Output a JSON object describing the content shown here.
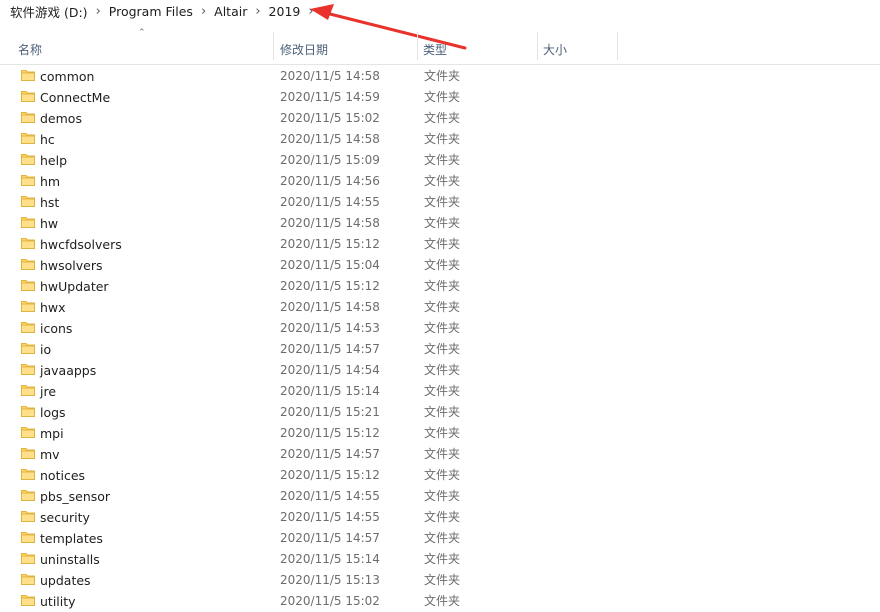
{
  "breadcrumb": {
    "items": [
      "软件游戏 (D:)",
      "Program Files",
      "Altair",
      "2019"
    ],
    "separator": "›"
  },
  "columns": {
    "name": "名称",
    "date": "修改日期",
    "type": "类型",
    "size": "大小"
  },
  "files": [
    {
      "name": "common",
      "date": "2020/11/5 14:58",
      "type": "文件夹"
    },
    {
      "name": "ConnectMe",
      "date": "2020/11/5 14:59",
      "type": "文件夹"
    },
    {
      "name": "demos",
      "date": "2020/11/5 15:02",
      "type": "文件夹"
    },
    {
      "name": "hc",
      "date": "2020/11/5 14:58",
      "type": "文件夹"
    },
    {
      "name": "help",
      "date": "2020/11/5 15:09",
      "type": "文件夹"
    },
    {
      "name": "hm",
      "date": "2020/11/5 14:56",
      "type": "文件夹"
    },
    {
      "name": "hst",
      "date": "2020/11/5 14:55",
      "type": "文件夹"
    },
    {
      "name": "hw",
      "date": "2020/11/5 14:58",
      "type": "文件夹"
    },
    {
      "name": "hwcfdsolvers",
      "date": "2020/11/5 15:12",
      "type": "文件夹"
    },
    {
      "name": "hwsolvers",
      "date": "2020/11/5 15:04",
      "type": "文件夹"
    },
    {
      "name": "hwUpdater",
      "date": "2020/11/5 15:12",
      "type": "文件夹"
    },
    {
      "name": "hwx",
      "date": "2020/11/5 14:58",
      "type": "文件夹"
    },
    {
      "name": "icons",
      "date": "2020/11/5 14:53",
      "type": "文件夹"
    },
    {
      "name": "io",
      "date": "2020/11/5 14:57",
      "type": "文件夹"
    },
    {
      "name": "javaapps",
      "date": "2020/11/5 14:54",
      "type": "文件夹"
    },
    {
      "name": "jre",
      "date": "2020/11/5 15:14",
      "type": "文件夹"
    },
    {
      "name": "logs",
      "date": "2020/11/5 15:21",
      "type": "文件夹"
    },
    {
      "name": "mpi",
      "date": "2020/11/5 15:12",
      "type": "文件夹"
    },
    {
      "name": "mv",
      "date": "2020/11/5 14:57",
      "type": "文件夹"
    },
    {
      "name": "notices",
      "date": "2020/11/5 15:12",
      "type": "文件夹"
    },
    {
      "name": "pbs_sensor",
      "date": "2020/11/5 14:55",
      "type": "文件夹"
    },
    {
      "name": "security",
      "date": "2020/11/5 14:55",
      "type": "文件夹"
    },
    {
      "name": "templates",
      "date": "2020/11/5 14:57",
      "type": "文件夹"
    },
    {
      "name": "uninstalls",
      "date": "2020/11/5 15:14",
      "type": "文件夹"
    },
    {
      "name": "updates",
      "date": "2020/11/5 15:13",
      "type": "文件夹"
    },
    {
      "name": "utility",
      "date": "2020/11/5 15:02",
      "type": "文件夹"
    }
  ],
  "icons": {
    "folder": "folder-icon",
    "sort": "sort-ascending-icon",
    "chevron": "chevron-right-icon",
    "annotation": "red-arrow-annotation"
  },
  "colors": {
    "folder": "#ffd35c",
    "header_text": "#4c607a",
    "annotation": "#e8322b"
  }
}
